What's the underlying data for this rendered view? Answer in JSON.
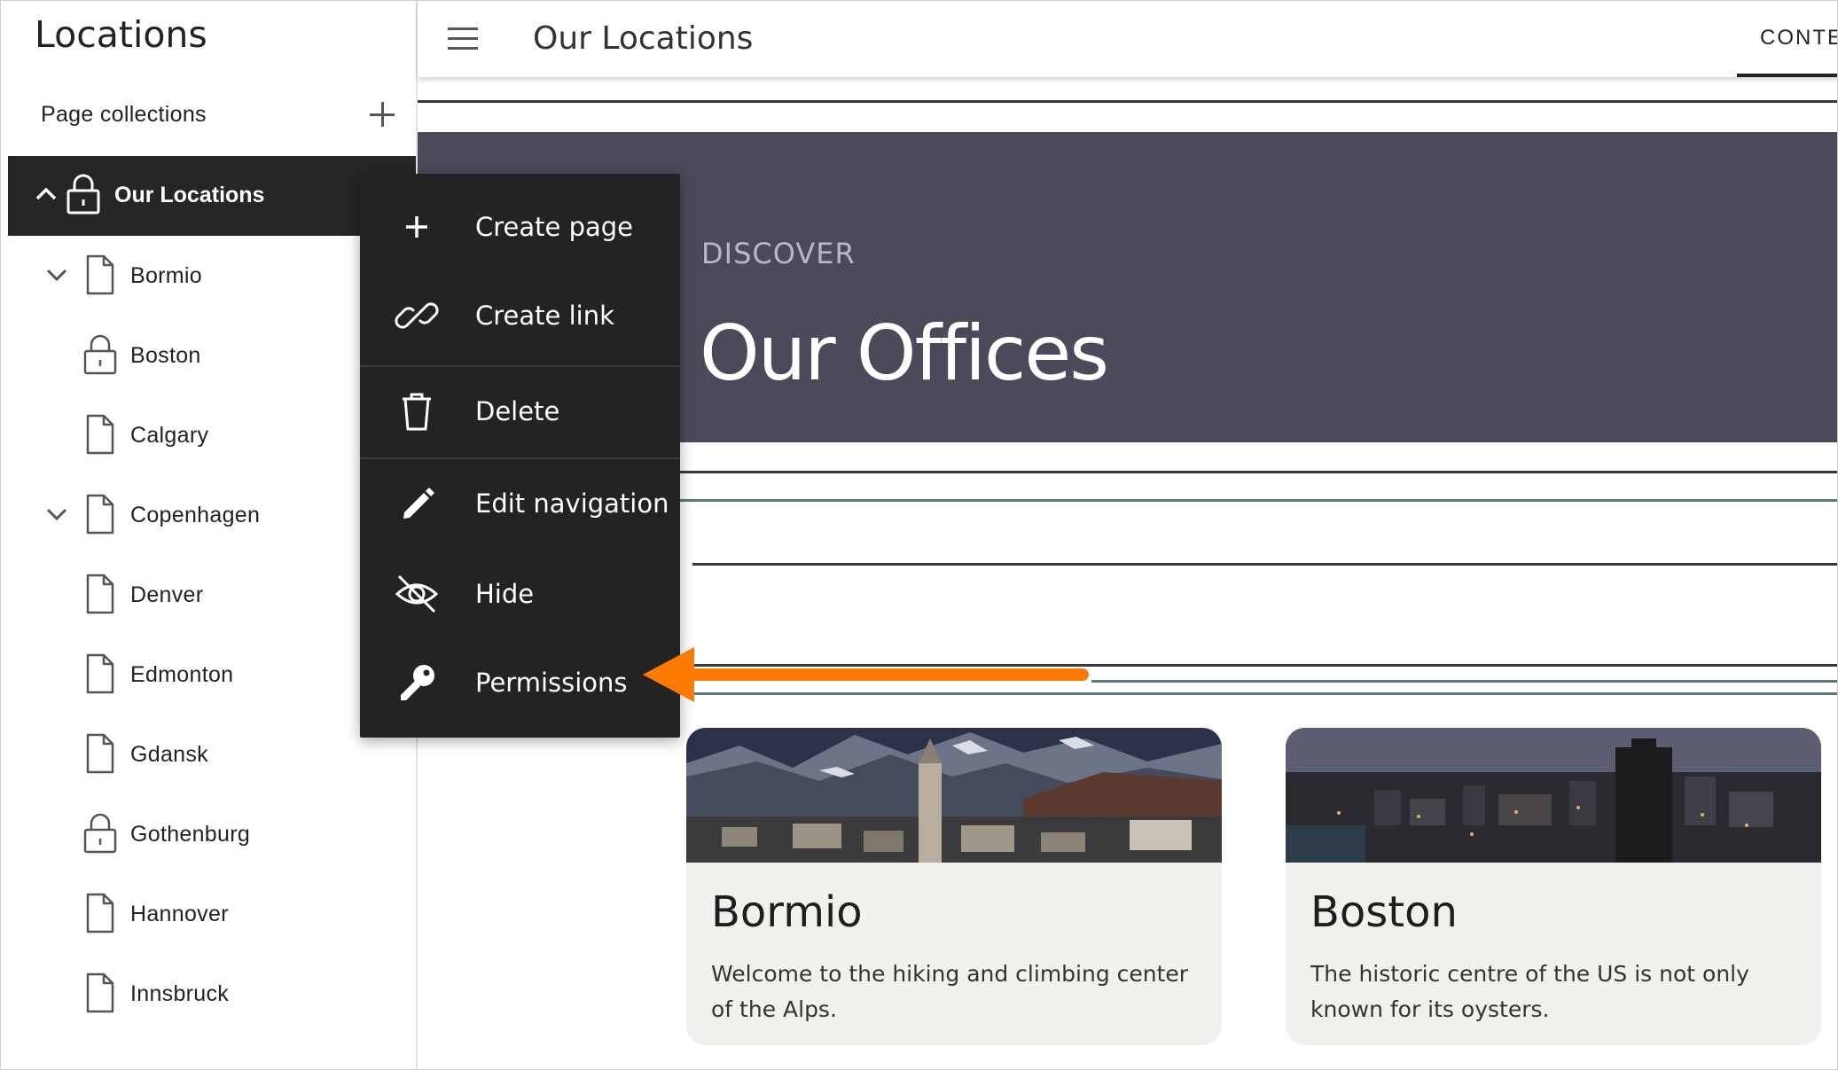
{
  "sidebar": {
    "title": "Locations",
    "collections_label": "Page collections",
    "active_item": "Our Locations",
    "items": [
      {
        "label": "Bormio",
        "icon": "page-icon",
        "expandable": true
      },
      {
        "label": "Boston",
        "icon": "lock-icon",
        "expandable": false
      },
      {
        "label": "Calgary",
        "icon": "page-icon",
        "expandable": false
      },
      {
        "label": "Copenhagen",
        "icon": "page-icon",
        "expandable": true
      },
      {
        "label": "Denver",
        "icon": "page-icon",
        "expandable": false
      },
      {
        "label": "Edmonton",
        "icon": "page-icon",
        "expandable": false
      },
      {
        "label": "Gdansk",
        "icon": "page-icon",
        "expandable": false
      },
      {
        "label": "Gothenburg",
        "icon": "lock-icon",
        "expandable": false
      },
      {
        "label": "Hannover",
        "icon": "page-icon",
        "expandable": false
      },
      {
        "label": "Innsbruck",
        "icon": "page-icon",
        "expandable": false
      }
    ]
  },
  "topbar": {
    "title": "Our Locations",
    "tab_label": "CONTE"
  },
  "hero": {
    "eyebrow": "DISCOVER",
    "title": "Our Offices"
  },
  "cards": [
    {
      "title": "Bormio",
      "text": "Welcome to the hiking and climbing center of the Alps."
    },
    {
      "title": "Boston",
      "text": "The historic centre of the US is not only known for its oysters."
    }
  ],
  "context_menu": {
    "items": [
      {
        "label": "Create page",
        "icon": "plus-icon"
      },
      {
        "label": "Create link",
        "icon": "link-icon"
      },
      {
        "label": "Delete",
        "icon": "trash-icon"
      },
      {
        "label": "Edit navigation",
        "icon": "pencil-icon"
      },
      {
        "label": "Hide",
        "icon": "eye-off-icon"
      },
      {
        "label": "Permissions",
        "icon": "key-icon"
      }
    ]
  },
  "colors": {
    "sidebar_active_bg": "#262626",
    "menu_bg": "#232323",
    "hero_bg": "#4a4a5a",
    "card_bg": "#f1f0ec",
    "annotation_arrow": "#ff7a00"
  }
}
